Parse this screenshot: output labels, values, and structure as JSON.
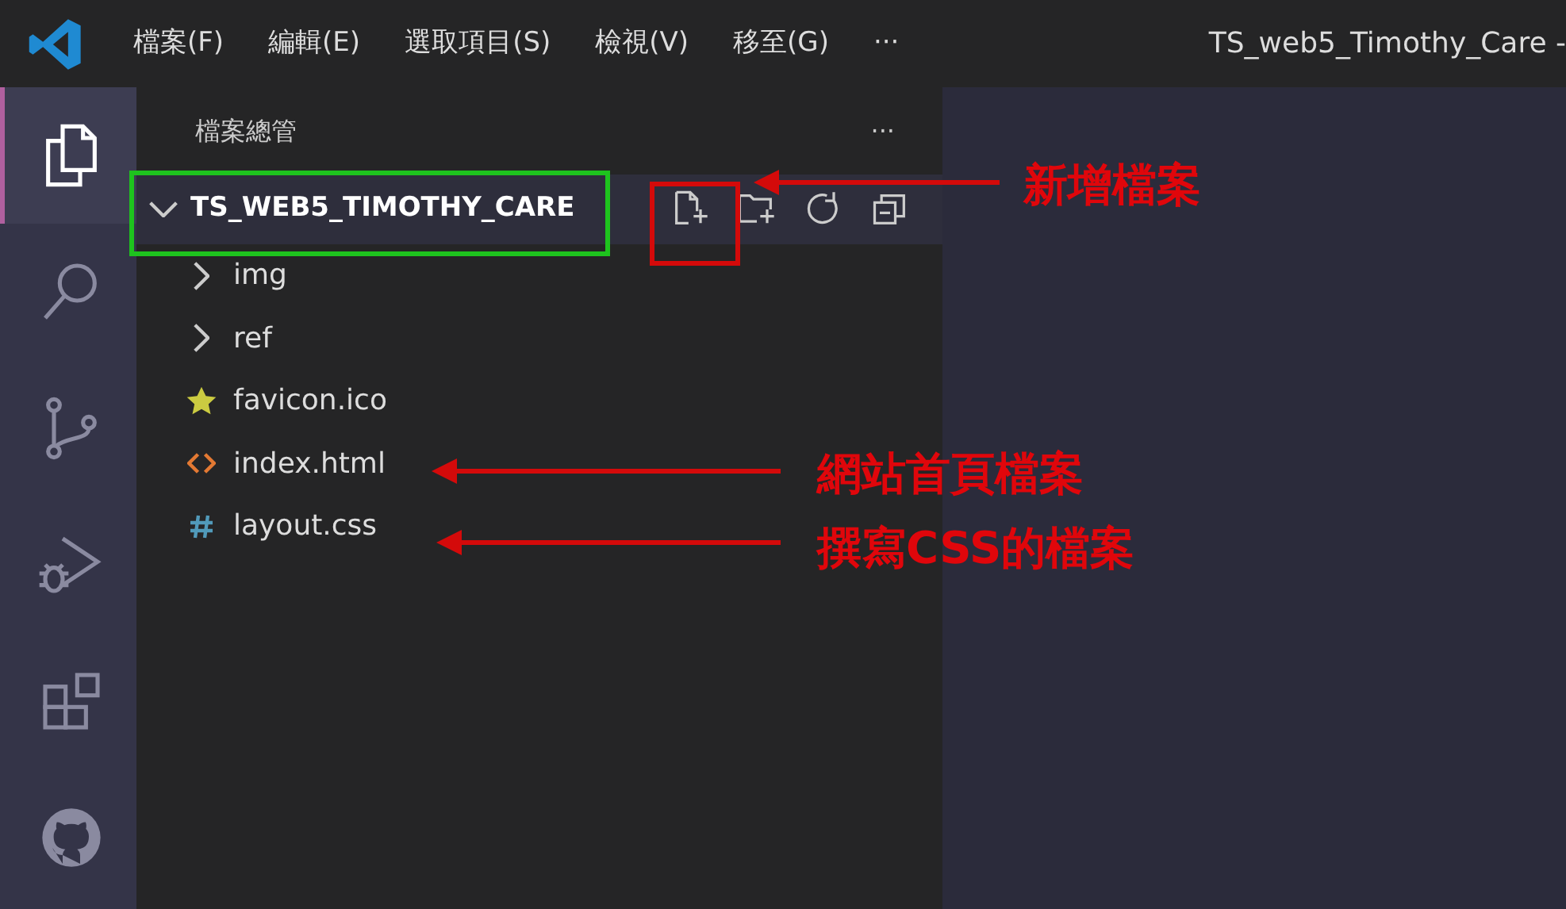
{
  "menu": [
    "檔案(F)",
    "編輯(E)",
    "選取項目(S)",
    "檢視(V)",
    "移至(G)",
    "···"
  ],
  "window": {
    "title": "TS_web5_Timothy_Care -"
  },
  "activity_bar": [
    {
      "kind": "explorer",
      "selected": true
    },
    {
      "kind": "search",
      "selected": false
    },
    {
      "kind": "source-control",
      "selected": false
    },
    {
      "kind": "run-debug",
      "selected": false
    },
    {
      "kind": "extensions",
      "selected": false
    },
    {
      "kind": "github",
      "selected": false
    }
  ],
  "explorer": {
    "title": "檔案總管",
    "more": "···",
    "root": {
      "label": "TS_WEB5_TIMOTHY_CARE",
      "expanded": true
    },
    "items": [
      {
        "label": "img",
        "kind": "folder",
        "expanded": false
      },
      {
        "label": "ref",
        "kind": "folder",
        "expanded": false
      },
      {
        "label": "favicon.ico",
        "kind": "favicon"
      },
      {
        "label": "index.html",
        "kind": "html"
      },
      {
        "label": "layout.css",
        "kind": "css"
      }
    ]
  },
  "frames": [
    {
      "color": "#1ec31e"
    },
    {
      "color": "#d40a0a"
    }
  ],
  "annotations": [
    {
      "text": "新增檔案"
    },
    {
      "text": "網站首頁檔案"
    },
    {
      "text": "撰寫CSS的檔案"
    }
  ]
}
